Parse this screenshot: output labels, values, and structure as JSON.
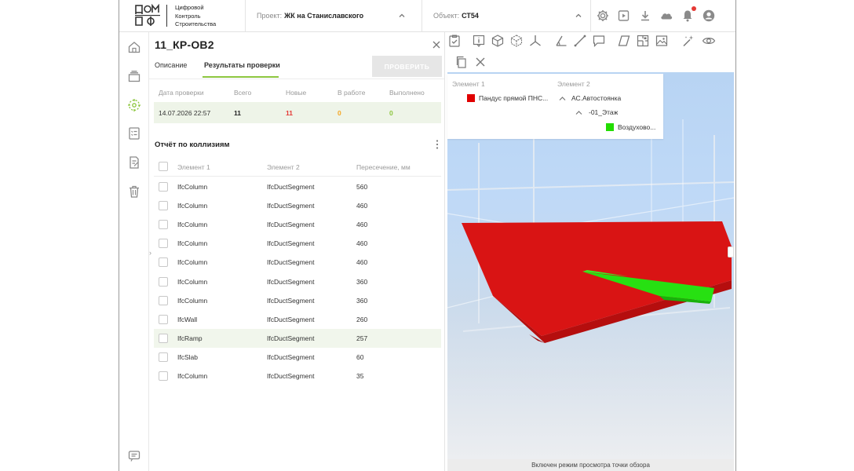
{
  "header": {
    "brand_lines": [
      "Цифровой",
      "Контроль",
      "Строительства"
    ],
    "project_label": "Проект:",
    "project_value": "ЖК на Станиславского",
    "object_label": "Объект:",
    "object_value": "СТ54",
    "icons": [
      "settings-icon",
      "play-video-icon",
      "download-icon",
      "cloud-icon",
      "bell-icon",
      "user-icon"
    ]
  },
  "rail": {
    "icons": [
      "home-icon",
      "layers-icon",
      "collision-check-icon",
      "checklist-icon",
      "document-edit-icon",
      "trash-icon",
      "chat-icon"
    ]
  },
  "panel": {
    "title": "11_КР-ОВ2",
    "tabs": [
      "Описание",
      "Результаты проверки"
    ],
    "active_tab": 1,
    "check_button": "ПРОВЕРИТЬ",
    "summary_headers": [
      "Дата проверки",
      "Всего",
      "Новые",
      "В работе",
      "Выполнено"
    ],
    "summary_values": {
      "date": "14.07.2026 22:57",
      "total": "11",
      "new": "11",
      "in_work": "0",
      "done": "0"
    },
    "report_title": "Отчёт по коллизиям",
    "table_headers": [
      "Элемент 1",
      "Элемент 2",
      "Пересечение, мм"
    ],
    "rows": [
      {
        "e1": "IfcColumn",
        "e2": "IfcDuctSegment",
        "mm": "560"
      },
      {
        "e1": "IfcColumn",
        "e2": "IfcDuctSegment",
        "mm": "460"
      },
      {
        "e1": "IfcColumn",
        "e2": "IfcDuctSegment",
        "mm": "460"
      },
      {
        "e1": "IfcColumn",
        "e2": "IfcDuctSegment",
        "mm": "460"
      },
      {
        "e1": "IfcColumn",
        "e2": "IfcDuctSegment",
        "mm": "460"
      },
      {
        "e1": "IfcColumn",
        "e2": "IfcDuctSegment",
        "mm": "360"
      },
      {
        "e1": "IfcColumn",
        "e2": "IfcDuctSegment",
        "mm": "360"
      },
      {
        "e1": "IfcWall",
        "e2": "IfcDuctSegment",
        "mm": "260"
      },
      {
        "e1": "IfcRamp",
        "e2": "IfcDuctSegment",
        "mm": "257"
      },
      {
        "e1": "IfcSlab",
        "e2": "IfcDuctSegment",
        "mm": "60"
      },
      {
        "e1": "IfcColumn",
        "e2": "IfcDuctSegment",
        "mm": "35"
      }
    ],
    "highlighted_row": 8
  },
  "viewer": {
    "tree": {
      "header1": "Элемент 1",
      "header2": "Элемент 2",
      "element1": "Пандус прямой ПНС...",
      "element1_color": "#e00000",
      "node1": "АС.Автостоянка",
      "node2": "-01_Этаж",
      "element2": "Воздухово...",
      "element2_color": "#22dd00"
    },
    "status": "Включен режим просмотра точки обзора"
  },
  "colors": {
    "accent": "#8dc63f",
    "new_count": "#e53935",
    "in_work_count": "#f5a623",
    "done_count": "#8dc63f"
  }
}
